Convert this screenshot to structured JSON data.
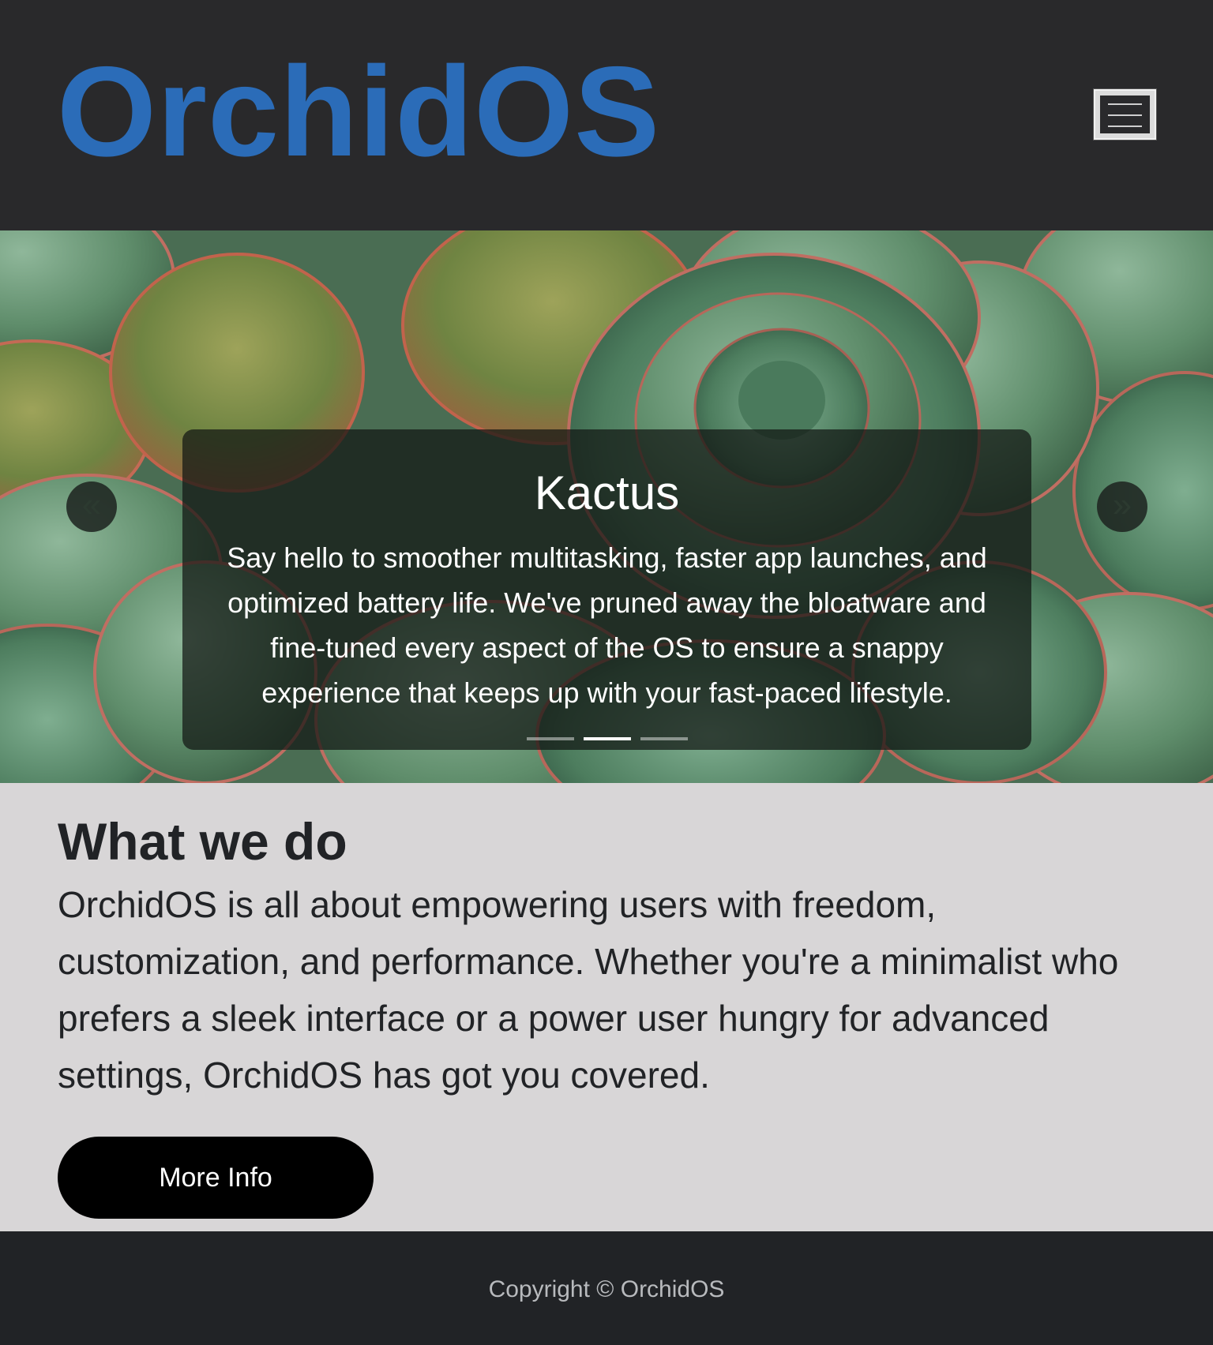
{
  "header": {
    "logo": "OrchidOS",
    "logo_color": "#2b6cb8",
    "menu_icon": "hamburger-icon"
  },
  "carousel": {
    "slide_title": "Kactus",
    "slide_text": "Say hello to smoother multitasking, faster app launches, and optimized battery life. We've pruned away the bloatware and fine-tuned every aspect of the OS to ensure a snappy experience that keeps up with your fast-paced lifestyle.",
    "prev_icon": "chevron-double-left-icon",
    "prev_glyph": "«",
    "next_icon": "chevron-double-right-icon",
    "next_glyph": "»",
    "slide_count": 3,
    "active_index": 1,
    "background_image": "succulent plant close-up"
  },
  "about": {
    "title": "What we do",
    "text": "OrchidOS is all about empowering users with freedom, customization, and performance. Whether you're a minimalist who prefers a sleek interface or a power user hungry for advanced settings, OrchidOS has got you covered.",
    "button_label": "More Info"
  },
  "footer": {
    "copyright": "Copyright © OrchidOS"
  }
}
